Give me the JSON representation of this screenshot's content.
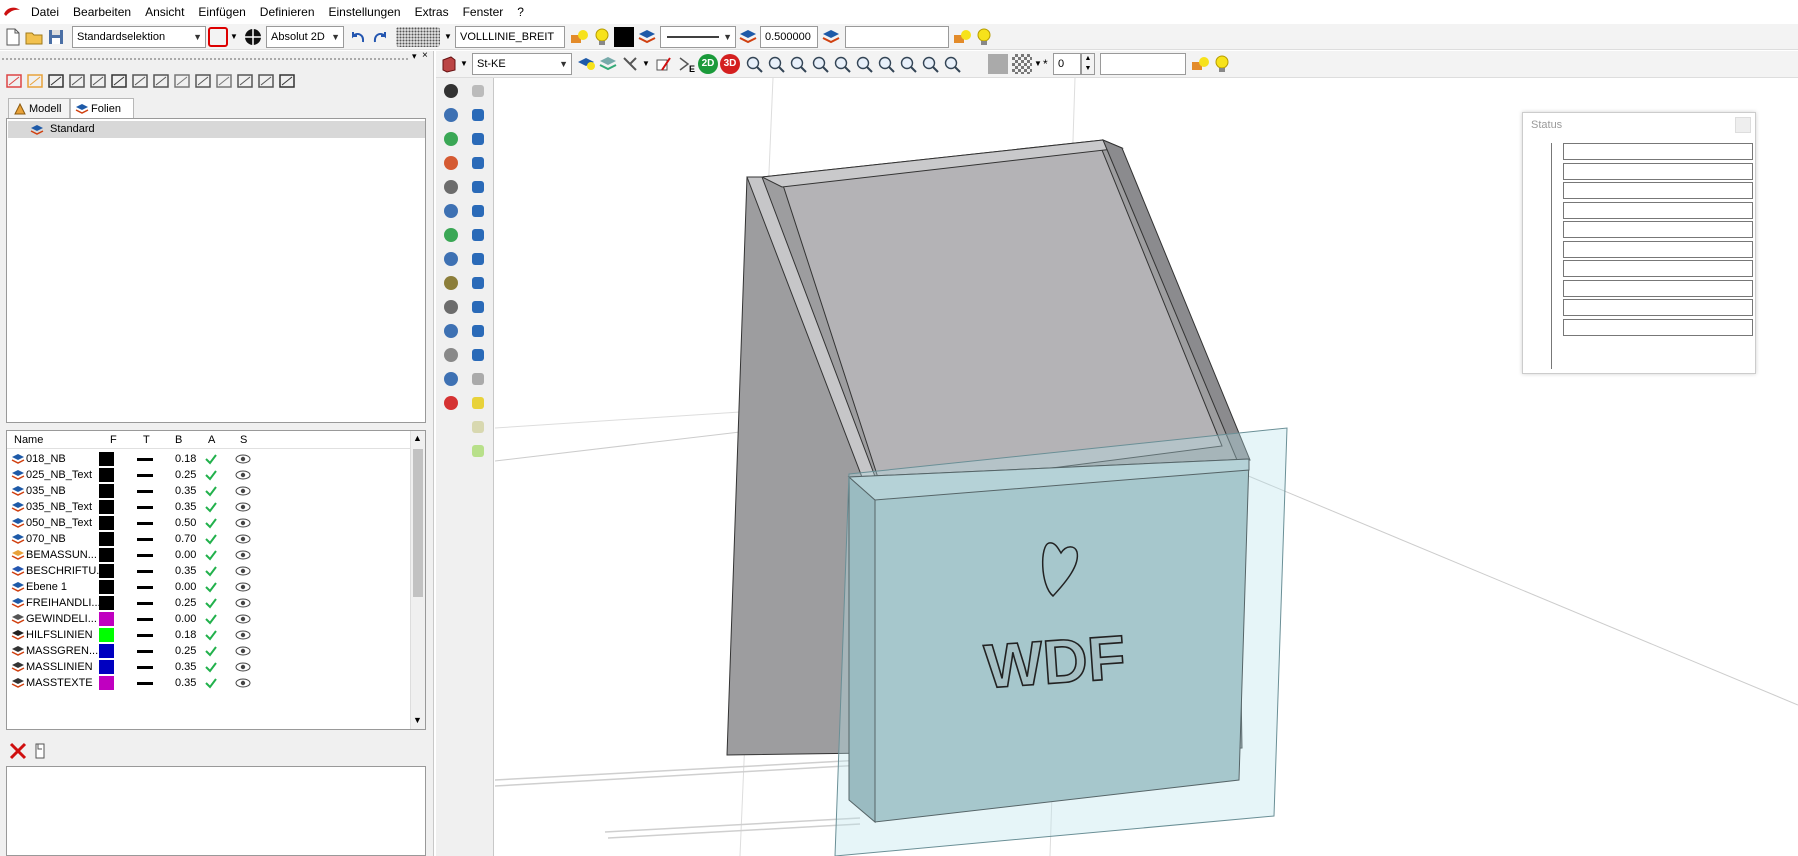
{
  "menu": [
    "Datei",
    "Bearbeiten",
    "Ansicht",
    "Einfügen",
    "Definieren",
    "Einstellungen",
    "Extras",
    "Fenster",
    "?"
  ],
  "toolbar1": {
    "selection_mode": "Standardselektion",
    "coordinate_mode": "Absolut 2D",
    "line_type": "VOLLLINIE_BREIT",
    "line_width": "0.500000",
    "text_field": ""
  },
  "toolbar2": {
    "material": "St-KE",
    "mode_2d": "2D",
    "mode_3d": "3D",
    "counter": "0",
    "text_field": ""
  },
  "tabs": [
    "Modell",
    "Folien"
  ],
  "tree_item": "Standard",
  "layer_headers": {
    "name": "Name",
    "f": "F",
    "t": "T",
    "b": "B",
    "a": "A",
    "s": "S"
  },
  "layers": [
    {
      "name": "018_NB",
      "color": "#000000",
      "b": "0.18"
    },
    {
      "name": "025_NB_Text",
      "color": "#000000",
      "b": "0.25"
    },
    {
      "name": "035_NB",
      "color": "#000000",
      "b": "0.35"
    },
    {
      "name": "035_NB_Text",
      "color": "#000000",
      "b": "0.35"
    },
    {
      "name": "050_NB_Text",
      "color": "#000000",
      "b": "0.50"
    },
    {
      "name": "070_NB",
      "color": "#000000",
      "b": "0.70"
    },
    {
      "name": "BEMASSUN...",
      "color": "#000000",
      "b": "0.00"
    },
    {
      "name": "BESCHRIFTU...",
      "color": "#000000",
      "b": "0.35"
    },
    {
      "name": "Ebene 1",
      "color": "#000000",
      "b": "0.00"
    },
    {
      "name": "FREIHANDLI...",
      "color": "#000000",
      "b": "0.25"
    },
    {
      "name": "GEWINDELI...",
      "color": "#c000c0",
      "b": "0.00"
    },
    {
      "name": "HILFSLINIEN",
      "color": "#00ff00",
      "b": "0.18"
    },
    {
      "name": "MASSGREN...",
      "color": "#0000c0",
      "b": "0.25"
    },
    {
      "name": "MASSLINIEN",
      "color": "#0000c0",
      "b": "0.35"
    },
    {
      "name": "MASSTEXTE",
      "color": "#c000c0",
      "b": "0.35"
    }
  ],
  "status_panel": {
    "title": "Status"
  },
  "model_text": "WDF"
}
